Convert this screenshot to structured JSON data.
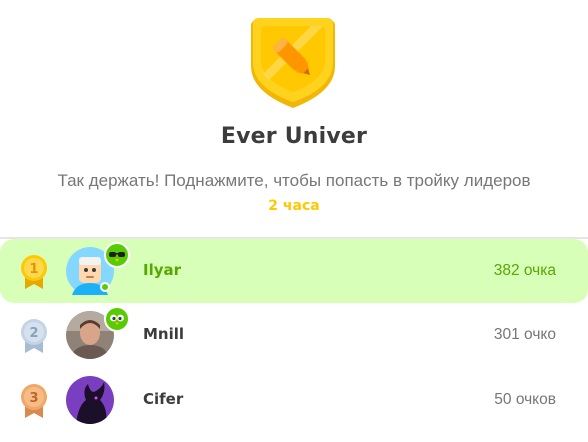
{
  "league": {
    "title": "Ever Univer",
    "subtitle": "Так держать! Поднажмите, чтобы попасть в тройку лидеров",
    "time_left": "2 часа"
  },
  "leaderboard": [
    {
      "rank": "1",
      "name": "Ilyar",
      "xp": "382 очка",
      "current_user": true,
      "medal": "gold-medal-icon"
    },
    {
      "rank": "2",
      "name": "Mnill",
      "xp": "301 очко",
      "current_user": false,
      "medal": "silver-medal-icon"
    },
    {
      "rank": "3",
      "name": "Cifer",
      "xp": "50 очков",
      "current_user": false,
      "medal": "bronze-medal-icon"
    }
  ],
  "colors": {
    "gold": "#ffc800",
    "silver": "#b8c9dd",
    "bronze": "#e8a26a",
    "highlight": "#d7ffb8",
    "accent_green": "#58a700"
  }
}
